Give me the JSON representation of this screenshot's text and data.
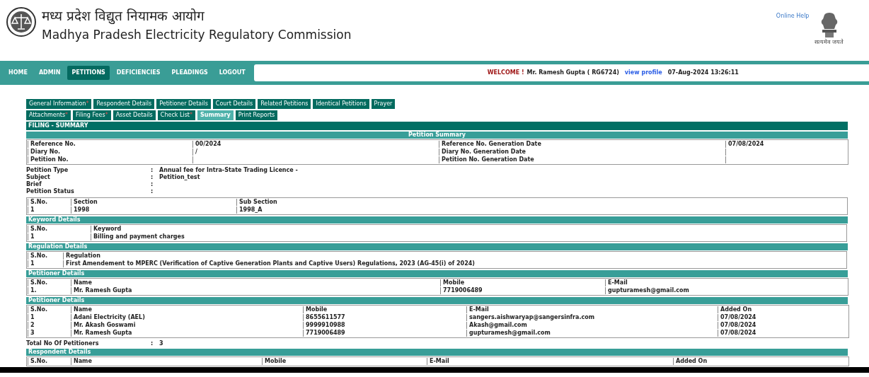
{
  "header": {
    "title_hindi": "मध्य प्रदेश विद्युत नियामक आयोग",
    "title_english": "Madhya Pradesh Electricity Regulatory Commission",
    "help_link": "Online Help",
    "motto": "सत्यमेव जयते"
  },
  "nav": {
    "items": [
      {
        "label": "HOME",
        "selected": false
      },
      {
        "label": "ADMIN",
        "selected": false
      },
      {
        "label": "PETITIONS",
        "selected": true
      },
      {
        "label": "DEFICIENCIES",
        "selected": false
      },
      {
        "label": "PLEADINGS",
        "selected": false
      },
      {
        "label": "LOGOUT",
        "selected": false
      }
    ],
    "welcome": {
      "greeting": "WELCOME !",
      "user": "Mr. Ramesh Gupta ( RG6724)",
      "link": "view profile",
      "datetime": "07-Aug-2024  13:26:11"
    }
  },
  "tab_rows": [
    {
      "tabs": [
        {
          "label": "General Information",
          "mark": "*",
          "selected": false
        },
        {
          "label": "Respondent Details",
          "selected": false
        },
        {
          "label": "Petitioner Details",
          "selected": false
        },
        {
          "label": "Court Details",
          "selected": false
        },
        {
          "label": "Related Petitions",
          "selected": false
        },
        {
          "label": "Identical Petitions",
          "selected": false
        },
        {
          "label": "Prayer",
          "selected": false
        }
      ]
    },
    {
      "tabs": [
        {
          "label": "Attachments",
          "mark": "*",
          "selected": false
        },
        {
          "label": "Filing Fees",
          "mark": "*",
          "selected": false
        },
        {
          "label": "Asset Details",
          "selected": false
        },
        {
          "label": "Check List",
          "mark": "*",
          "selected": false
        },
        {
          "label": "Summary",
          "selected": true
        },
        {
          "label": "Print Reports",
          "selected": false
        }
      ]
    }
  ],
  "page_title": "FILING - SUMMARY",
  "summary": {
    "title": "Petition Summary",
    "rows": [
      [
        "Reference No.",
        "00/2024",
        "Reference No. Generation Date",
        "07/08/2024"
      ],
      [
        "Diary No.",
        "/",
        "Diary No. Generation Date",
        ""
      ],
      [
        "Petition No.",
        "",
        "Petition No. Generation Date",
        ""
      ]
    ]
  },
  "fields": [
    {
      "label": "Petition Type",
      "colon": ":",
      "value": "Annual fee for Intra-State Trading Licence -"
    },
    {
      "label": "Subject",
      "colon": ":",
      "value": "Petition_test"
    },
    {
      "label": "Brief",
      "colon": ":"
    },
    {
      "label": "Petition Status",
      "colon": ":"
    }
  ],
  "sections": [
    {
      "columns": [
        "S.No.",
        "Section",
        "Sub Section"
      ],
      "rows": [
        [
          "1",
          "1998",
          "1998_A"
        ]
      ]
    },
    {
      "title": "Keyword Details",
      "columns": [
        "S.No.",
        "Keyword"
      ],
      "rows": [
        [
          "1",
          "Billing and payment charges"
        ]
      ]
    },
    {
      "title": "Regulation Details",
      "columns": [
        "S.No.",
        "Regulation"
      ],
      "rows": [
        [
          "1",
          "First Amendement to MPERC (Verification of Captive Generation Plants and Captive Users) Regulations, 2023 (AG-45(i) of 2024)"
        ]
      ]
    },
    {
      "title": "Petitioner Details",
      "columns": [
        "S.No.",
        "Name",
        "Mobile",
        "E-Mail"
      ],
      "rows": [
        [
          "1.",
          "Mr. Ramesh Gupta",
          "7719006489",
          "gupturamesh@gmail.com"
        ]
      ]
    },
    {
      "title": "Petitioner Details",
      "columns": [
        "S.No.",
        "Name",
        "Mobile",
        "E-Mail",
        "Added On"
      ],
      "rows": [
        [
          "1",
          "Adani Electricity (AEL)",
          "8655611577",
          "sangers.aishwaryap@sangersinfra.com",
          "07/08/2024"
        ],
        [
          "2",
          "Mr. Akash Goswami",
          "9999910988",
          "Akash@gmail.com",
          "07/08/2024"
        ],
        [
          "3",
          "Mr. Ramesh Gupta",
          "7719006489",
          "gupturamesh@gmail.com",
          "07/08/2024"
        ]
      ],
      "total": {
        "label": "Total No Of Petitioners",
        "colon": ":",
        "value": "3"
      }
    },
    {
      "title": "Respondent Details",
      "columns": [
        "S.No.",
        "Name",
        "Mobile",
        "E-Mail",
        "Added On"
      ]
    }
  ]
}
